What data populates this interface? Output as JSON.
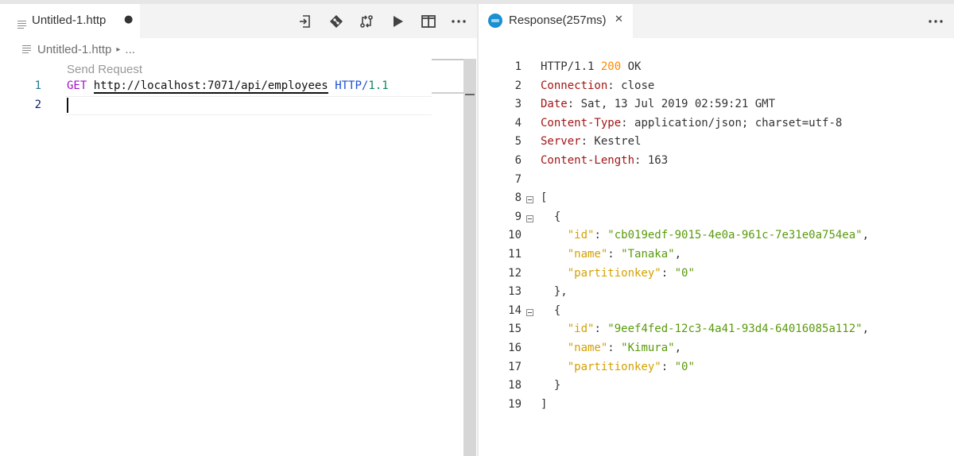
{
  "left": {
    "tab_title": "Untitled-1.http",
    "dirty_indicator": "●",
    "actions": [
      "split-request-icon",
      "git-diamond-icon",
      "compare-changes-icon",
      "run-icon",
      "split-editor-icon",
      "more-actions-icon"
    ],
    "breadcrumb_file": "Untitled-1.http",
    "breadcrumb_sep": "▸",
    "breadcrumb_more": "...",
    "codelens": "Send Request",
    "lines": [
      {
        "num": "1",
        "method": "GET",
        "url": "http://localhost:7071/api/employees",
        "http": "HTTP/",
        "version": "1.1"
      },
      {
        "num": "2"
      }
    ]
  },
  "right": {
    "tab_title": "Response(257ms)",
    "close_glyph": "✕",
    "more_glyph": "···",
    "lines": [
      {
        "num": "1",
        "parts": [
          {
            "t": "HTTP/1.1 ",
            "c": "val"
          },
          {
            "t": "200",
            "c": "num"
          },
          {
            "t": " OK",
            "c": "val"
          }
        ]
      },
      {
        "num": "2",
        "parts": [
          {
            "t": "Connection",
            "c": "key"
          },
          {
            "t": ": close",
            "c": "val"
          }
        ]
      },
      {
        "num": "3",
        "parts": [
          {
            "t": "Date",
            "c": "key"
          },
          {
            "t": ": Sat, 13 Jul 2019 02:59:21 GMT",
            "c": "val"
          }
        ]
      },
      {
        "num": "4",
        "parts": [
          {
            "t": "Content-Type",
            "c": "key"
          },
          {
            "t": ": application/json; charset=utf-8",
            "c": "val"
          }
        ]
      },
      {
        "num": "5",
        "parts": [
          {
            "t": "Server",
            "c": "key"
          },
          {
            "t": ": Kestrel",
            "c": "val"
          }
        ]
      },
      {
        "num": "6",
        "parts": [
          {
            "t": "Content-Length",
            "c": "key"
          },
          {
            "t": ": 163",
            "c": "val"
          }
        ]
      },
      {
        "num": "7",
        "parts": []
      },
      {
        "num": "8",
        "fold": true,
        "parts": [
          {
            "t": "[",
            "c": "val"
          }
        ]
      },
      {
        "num": "9",
        "fold": true,
        "parts": [
          {
            "t": "  {",
            "c": "val"
          }
        ]
      },
      {
        "num": "10",
        "parts": [
          {
            "t": "    ",
            "c": "val"
          },
          {
            "t": "\"id\"",
            "c": "jkey"
          },
          {
            "t": ": ",
            "c": "val"
          },
          {
            "t": "\"cb019edf-9015-4e0a-961c-7e31e0a754ea\"",
            "c": "jstr"
          },
          {
            "t": ",",
            "c": "val"
          }
        ]
      },
      {
        "num": "11",
        "parts": [
          {
            "t": "    ",
            "c": "val"
          },
          {
            "t": "\"name\"",
            "c": "jkey"
          },
          {
            "t": ": ",
            "c": "val"
          },
          {
            "t": "\"Tanaka\"",
            "c": "jstr"
          },
          {
            "t": ",",
            "c": "val"
          }
        ]
      },
      {
        "num": "12",
        "parts": [
          {
            "t": "    ",
            "c": "val"
          },
          {
            "t": "\"partitionkey\"",
            "c": "jkey"
          },
          {
            "t": ": ",
            "c": "val"
          },
          {
            "t": "\"0\"",
            "c": "jstr"
          }
        ]
      },
      {
        "num": "13",
        "parts": [
          {
            "t": "  },",
            "c": "val"
          }
        ]
      },
      {
        "num": "14",
        "fold": true,
        "parts": [
          {
            "t": "  {",
            "c": "val"
          }
        ]
      },
      {
        "num": "15",
        "parts": [
          {
            "t": "    ",
            "c": "val"
          },
          {
            "t": "\"id\"",
            "c": "jkey"
          },
          {
            "t": ": ",
            "c": "val"
          },
          {
            "t": "\"9eef4fed-12c3-4a41-93d4-64016085a112\"",
            "c": "jstr"
          },
          {
            "t": ",",
            "c": "val"
          }
        ]
      },
      {
        "num": "16",
        "parts": [
          {
            "t": "    ",
            "c": "val"
          },
          {
            "t": "\"name\"",
            "c": "jkey"
          },
          {
            "t": ": ",
            "c": "val"
          },
          {
            "t": "\"Kimura\"",
            "c": "jstr"
          },
          {
            "t": ",",
            "c": "val"
          }
        ]
      },
      {
        "num": "17",
        "parts": [
          {
            "t": "    ",
            "c": "val"
          },
          {
            "t": "\"partitionkey\"",
            "c": "jkey"
          },
          {
            "t": ": ",
            "c": "val"
          },
          {
            "t": "\"0\"",
            "c": "jstr"
          }
        ]
      },
      {
        "num": "18",
        "parts": [
          {
            "t": "  }",
            "c": "val"
          }
        ]
      },
      {
        "num": "19",
        "parts": [
          {
            "t": "]",
            "c": "val"
          }
        ]
      }
    ]
  }
}
